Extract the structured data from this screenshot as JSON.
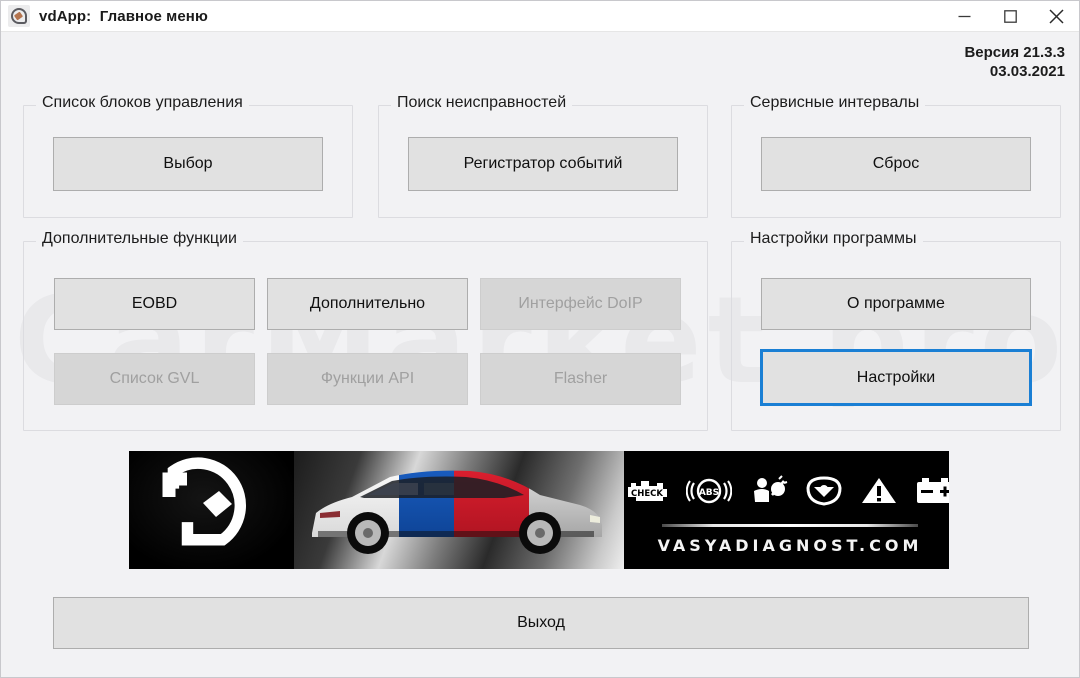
{
  "window": {
    "title": "vdApp:  Главное меню",
    "icon": "vdapp-logo-icon",
    "controls": {
      "minimize": "minimize-icon",
      "maximize": "maximize-icon",
      "close": "close-icon"
    }
  },
  "version": {
    "line1": "Версия 21.3.3",
    "line2": "03.03.2021"
  },
  "watermark": "CarMarket.pro",
  "groups": {
    "control_units": {
      "title": "Список блоков управления",
      "buttons": [
        {
          "label": "Выбор",
          "enabled": true,
          "focused": false
        }
      ]
    },
    "fault_search": {
      "title": "Поиск неисправностей",
      "buttons": [
        {
          "label": "Регистратор событий",
          "enabled": true,
          "focused": false
        }
      ]
    },
    "service_intervals": {
      "title": "Сервисные интервалы",
      "buttons": [
        {
          "label": "Сброс",
          "enabled": true,
          "focused": false
        }
      ]
    },
    "extra_functions": {
      "title": "Дополнительные функции",
      "buttons": [
        {
          "label": "EOBD",
          "enabled": true,
          "focused": false
        },
        {
          "label": "Дополнительно",
          "enabled": true,
          "focused": false
        },
        {
          "label": "Интерфейс DoIP",
          "enabled": false,
          "focused": false
        },
        {
          "label": "Список GVL",
          "enabled": false,
          "focused": false
        },
        {
          "label": "Функции API",
          "enabled": false,
          "focused": false
        },
        {
          "label": "Flasher",
          "enabled": false,
          "focused": false
        }
      ]
    },
    "program_settings": {
      "title": "Настройки программы",
      "buttons": [
        {
          "label": "О программе",
          "enabled": true,
          "focused": false
        },
        {
          "label": "Настройки",
          "enabled": true,
          "focused": true
        }
      ]
    }
  },
  "banner": {
    "logo_alt": "vasya-diagnost-logo",
    "car_alt": "skoda-superb-car-photo",
    "url": "VASYADIAGNOST.COM",
    "icons": [
      "check-engine-icon",
      "abs-icon",
      "airbag-icon",
      "steering-wheel-icon",
      "warning-triangle-icon",
      "battery-icon"
    ]
  },
  "exit": {
    "label": "Выход"
  },
  "colors": {
    "window_background": "#f2f2f4",
    "button_face": "#e1e1e1",
    "button_border": "#adadad",
    "disabled_text": "#a0a0a0",
    "focus_accent": "#1a7fd4",
    "banner_background": "#000000"
  }
}
